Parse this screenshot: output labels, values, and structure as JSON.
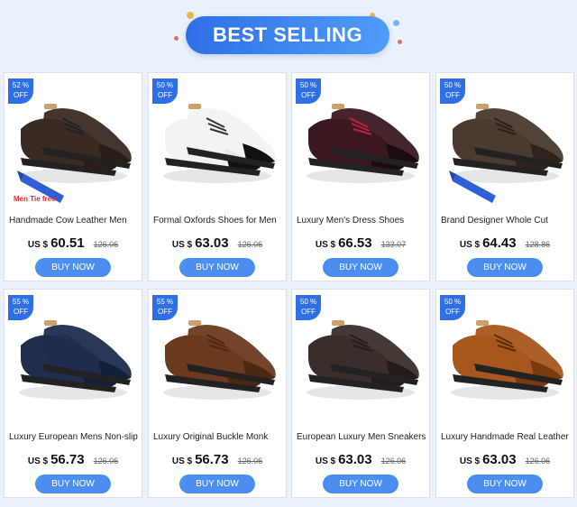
{
  "banner": {
    "title": "BEST SELLING"
  },
  "colors": {
    "accent": "#2f6fe6",
    "button": "#4a8ff0",
    "page_bg": "#e9f1fb",
    "tie_note": "#e0282e"
  },
  "products": [
    {
      "discount_pct": "52 %",
      "discount_off": "OFF",
      "image_note": "Men Tie free",
      "title": "Handmade Cow Leather Men",
      "currency": "US $",
      "price": "60.51",
      "old_price": "126.06",
      "cta": "BUY NOW",
      "shoe_color": "#3a2a24",
      "toe_color": "#2a1d18",
      "laces": "#222",
      "tie": true
    },
    {
      "discount_pct": "50 %",
      "discount_off": "OFF",
      "image_note": "",
      "title": "Formal Oxfords Shoes for Men",
      "currency": "US $",
      "price": "63.03",
      "old_price": "126.06",
      "cta": "BUY NOW",
      "shoe_color": "#f2f2f2",
      "toe_color": "#111111",
      "laces": "#333",
      "tie": false
    },
    {
      "discount_pct": "50 %",
      "discount_off": "OFF",
      "image_note": "",
      "title": "Luxury Men's Dress Shoes",
      "currency": "US $",
      "price": "66.53",
      "old_price": "133.07",
      "cta": "BUY NOW",
      "shoe_color": "#3b1820",
      "toe_color": "#1a0c10",
      "laces": "#c02040",
      "tie": false
    },
    {
      "discount_pct": "50 %",
      "discount_off": "OFF",
      "image_note": "",
      "title": "Brand Designer Whole Cut",
      "currency": "US $",
      "price": "64.43",
      "old_price": "128.86",
      "cta": "BUY NOW",
      "shoe_color": "#4a3a30",
      "toe_color": "#2e231d",
      "laces": "#2a1f1a",
      "tie": true
    },
    {
      "discount_pct": "55 %",
      "discount_off": "OFF",
      "image_note": "",
      "title": "Luxury European Mens Non-slip",
      "currency": "US $",
      "price": "56.73",
      "old_price": "126.06",
      "cta": "BUY NOW",
      "shoe_color": "#1f2d4e",
      "toe_color": "#142038",
      "laces": "#1f2d4e",
      "tie": false
    },
    {
      "discount_pct": "55 %",
      "discount_off": "OFF",
      "image_note": "",
      "title": "Luxury Original Buckle Monk",
      "currency": "US $",
      "price": "56.73",
      "old_price": "126.06",
      "cta": "BUY NOW",
      "shoe_color": "#6b3a1e",
      "toe_color": "#4a2812",
      "laces": "#4a2812",
      "tie": false
    },
    {
      "discount_pct": "50 %",
      "discount_off": "OFF",
      "image_note": "",
      "title": "European Luxury Men Sneakers",
      "currency": "US $",
      "price": "63.03",
      "old_price": "126.06",
      "cta": "BUY NOW",
      "shoe_color": "#3a2e2a",
      "toe_color": "#241c19",
      "laces": "#241c19",
      "tie": false
    },
    {
      "discount_pct": "50 %",
      "discount_off": "OFF",
      "image_note": "",
      "title": "Luxury Handmade Real Leather",
      "currency": "US $",
      "price": "63.03",
      "old_price": "126.06",
      "cta": "BUY NOW",
      "shoe_color": "#a8561e",
      "toe_color": "#7a3a10",
      "laces": "#5a2a0a",
      "tie": false
    }
  ]
}
